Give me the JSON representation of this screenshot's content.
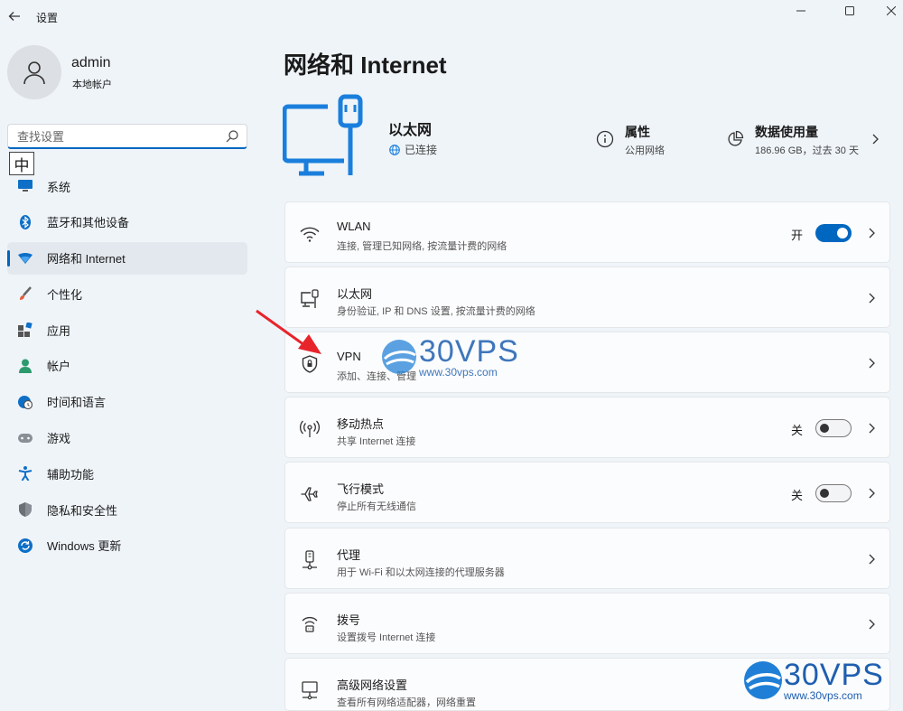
{
  "app": {
    "title": "设置"
  },
  "user": {
    "name": "admin",
    "account_type": "本地帐户"
  },
  "search": {
    "placeholder": "查找设置"
  },
  "ime": {
    "label": "中"
  },
  "sidebar": {
    "items": [
      {
        "label": "系统",
        "icon": "monitor-icon",
        "active": false
      },
      {
        "label": "蓝牙和其他设备",
        "icon": "bluetooth-icon",
        "active": false
      },
      {
        "label": "网络和 Internet",
        "icon": "wifi-icon",
        "active": true
      },
      {
        "label": "个性化",
        "icon": "brush-icon",
        "active": false
      },
      {
        "label": "应用",
        "icon": "apps-icon",
        "active": false
      },
      {
        "label": "帐户",
        "icon": "person-icon",
        "active": false
      },
      {
        "label": "时间和语言",
        "icon": "globe-clock-icon",
        "active": false
      },
      {
        "label": "游戏",
        "icon": "gamepad-icon",
        "active": false
      },
      {
        "label": "辅助功能",
        "icon": "accessibility-icon",
        "active": false
      },
      {
        "label": "隐私和安全性",
        "icon": "shield-icon",
        "active": false
      },
      {
        "label": "Windows 更新",
        "icon": "update-icon",
        "active": false
      }
    ]
  },
  "main": {
    "title": "网络和 Internet",
    "hero": {
      "name": "以太网",
      "status": "已连接",
      "properties": {
        "title": "属性",
        "subtitle": "公用网络"
      },
      "data_usage": {
        "title": "数据使用量",
        "subtitle": "186.96 GB，过去 30 天"
      }
    },
    "cards": [
      {
        "title": "WLAN",
        "subtitle": "连接, 管理已知网络, 按流量计费的网络",
        "icon": "wifi-icon",
        "toggle": {
          "label": "开",
          "on": true
        }
      },
      {
        "title": "以太网",
        "subtitle": "身份验证, IP 和 DNS 设置, 按流量计费的网络",
        "icon": "ethernet-icon"
      },
      {
        "title": "VPN",
        "subtitle": "添加、连接、管理",
        "icon": "vpn-shield-icon"
      },
      {
        "title": "移动热点",
        "subtitle": "共享 Internet 连接",
        "icon": "hotspot-icon",
        "toggle": {
          "label": "关",
          "on": false
        }
      },
      {
        "title": "飞行模式",
        "subtitle": "停止所有无线通信",
        "icon": "airplane-icon",
        "toggle": {
          "label": "关",
          "on": false
        }
      },
      {
        "title": "代理",
        "subtitle": "用于 Wi-Fi 和以太网连接的代理服务器",
        "icon": "proxy-icon"
      },
      {
        "title": "拨号",
        "subtitle": "设置拨号 Internet 连接",
        "icon": "dialup-icon"
      },
      {
        "title": "高级网络设置",
        "subtitle": "查看所有网络适配器，网络重置",
        "icon": "advanced-network-icon"
      }
    ]
  },
  "watermark": {
    "brand": "30VPS",
    "url": "www.30vps.com"
  },
  "colors": {
    "accent": "#0067c0",
    "background": "#eff4f9",
    "card": "#fbfcfd",
    "watermark": "#1f5fb0"
  }
}
